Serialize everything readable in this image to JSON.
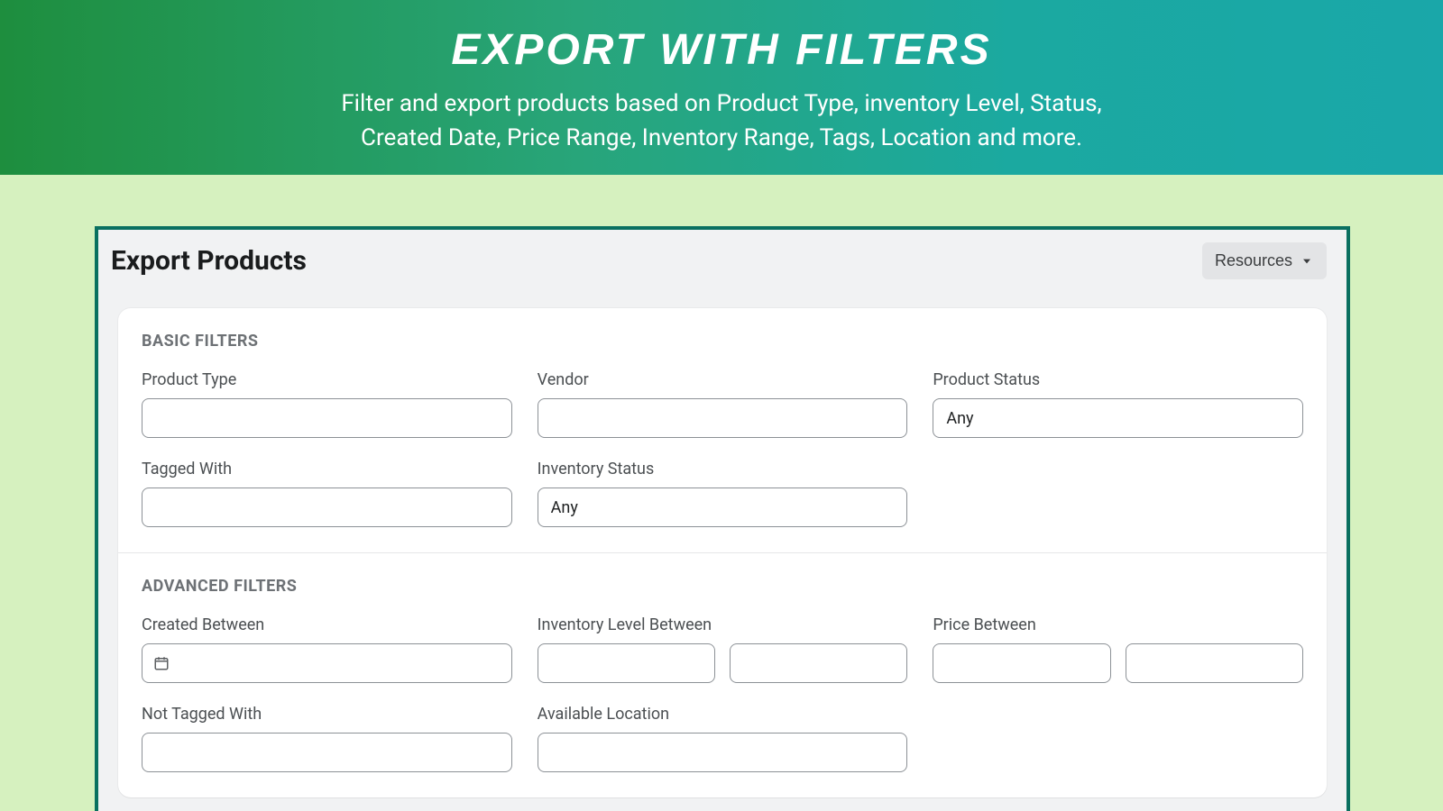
{
  "hero": {
    "title": "EXPORT WITH FILTERS",
    "subtitle_line1": "Filter and export products based on Product Type, inventory Level, Status,",
    "subtitle_line2": "Created Date, Price Range, Inventory Range, Tags, Location and more."
  },
  "page": {
    "title": "Export Products",
    "resources_label": "Resources"
  },
  "basic": {
    "section_title": "BASIC FILTERS",
    "product_type": {
      "label": "Product Type",
      "value": ""
    },
    "vendor": {
      "label": "Vendor",
      "value": ""
    },
    "product_status": {
      "label": "Product Status",
      "value": "Any"
    },
    "tagged_with": {
      "label": "Tagged With",
      "value": ""
    },
    "inventory_status": {
      "label": "Inventory Status",
      "value": "Any"
    }
  },
  "advanced": {
    "section_title": "ADVANCED FILTERS",
    "created_between": {
      "label": "Created Between",
      "value": ""
    },
    "inventory_level_between": {
      "label": "Inventory Level Between",
      "from": "",
      "to": ""
    },
    "price_between": {
      "label": "Price Between",
      "from": "",
      "to": ""
    },
    "not_tagged_with": {
      "label": "Not Tagged With",
      "value": ""
    },
    "available_location": {
      "label": "Available Location",
      "value": ""
    }
  }
}
